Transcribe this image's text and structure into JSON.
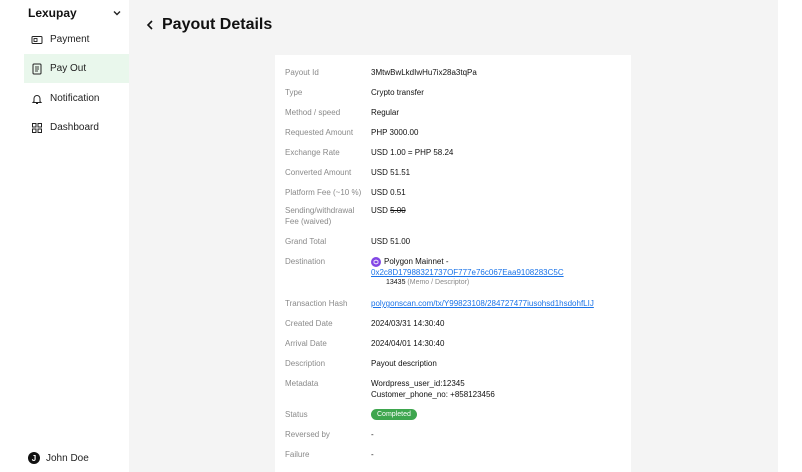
{
  "sidebar": {
    "brand": "Lexupay",
    "items": [
      {
        "label": "Payment",
        "icon": "payment-icon"
      },
      {
        "label": "Pay Out",
        "icon": "payout-icon",
        "active": true
      },
      {
        "label": "Notification",
        "icon": "bell-icon"
      },
      {
        "label": "Dashboard",
        "icon": "grid-icon"
      }
    ],
    "user": {
      "initial": "J",
      "name": "John Doe"
    }
  },
  "header": {
    "title": "Payout Details"
  },
  "details": {
    "payout_id": {
      "label": "Payout Id",
      "value": "3MtwBwLkdIwHu7ix28a3tqPa"
    },
    "type": {
      "label": "Type",
      "value": "Crypto transfer"
    },
    "method": {
      "label": "Method / speed",
      "value": "Regular"
    },
    "requested": {
      "label": "Requested Amount",
      "value": "PHP 3000.00"
    },
    "exchange": {
      "label": "Exchange Rate",
      "value": "USD 1.00 = PHP 58.24"
    },
    "converted": {
      "label": "Converted Amount",
      "value": "USD 51.51"
    },
    "platform_fee": {
      "label": "Platform Fee (~10 %)",
      "value": "USD 0.51"
    },
    "sending_fee": {
      "label_line1": "Sending/withdrawal",
      "label_line2": "Fee (waived)",
      "currency": "USD",
      "value": "5.00"
    },
    "grand_total": {
      "label": "Grand Total",
      "value": "USD 51.00"
    },
    "destination": {
      "label": "Destination",
      "network": "Polygon Mainnet -",
      "address": "0x2c8D17988321737OF777e76c067Eaa9108283C5C",
      "memo_value": "13435",
      "memo_tag": "(Memo / Descriptor)"
    },
    "tx_hash": {
      "label": "Transaction Hash",
      "value": "polygonscan.com/tx/Y99823108/284727477iusohsd1hsdohfLIJ"
    },
    "created": {
      "label": "Created Date",
      "value": "2024/03/31 14:30:40"
    },
    "arrival": {
      "label": "Arrival Date",
      "value": "2024/04/01 14:30:40"
    },
    "description": {
      "label": "Description",
      "value": "Payout description"
    },
    "metadata": {
      "label": "Metadata",
      "line1": "Wordpress_user_id:12345",
      "line2": "Customer_phone_no: +858123456"
    },
    "status": {
      "label": "Status",
      "value": "Completed"
    },
    "reversed_by": {
      "label": "Reversed by",
      "value": "-"
    },
    "failure": {
      "label": "Failure",
      "value": "-"
    }
  },
  "colors": {
    "accent_green": "#3ea64e",
    "active_bg": "#e9f7ec",
    "link": "#1a73e8",
    "polygon": "#8247e5"
  }
}
